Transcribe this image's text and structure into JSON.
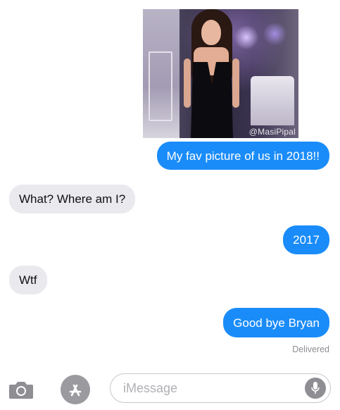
{
  "photo": {
    "watermark": "@MasiPipal"
  },
  "messages": [
    {
      "text": "My fav picture of us in 2018!!",
      "from": "me"
    },
    {
      "text": "What? Where am I?",
      "from": "them"
    },
    {
      "text": "2017",
      "from": "me"
    },
    {
      "text": "Wtf",
      "from": "them"
    },
    {
      "text": "Good bye Bryan",
      "from": "me"
    }
  ],
  "status": "Delivered",
  "composer": {
    "placeholder": "iMessage"
  },
  "icons": {
    "camera": "camera-icon",
    "app_store": "app-store-icon",
    "mic": "microphone-icon"
  },
  "colors": {
    "sent": "#1a8cf9",
    "received": "#e9e9ee"
  }
}
